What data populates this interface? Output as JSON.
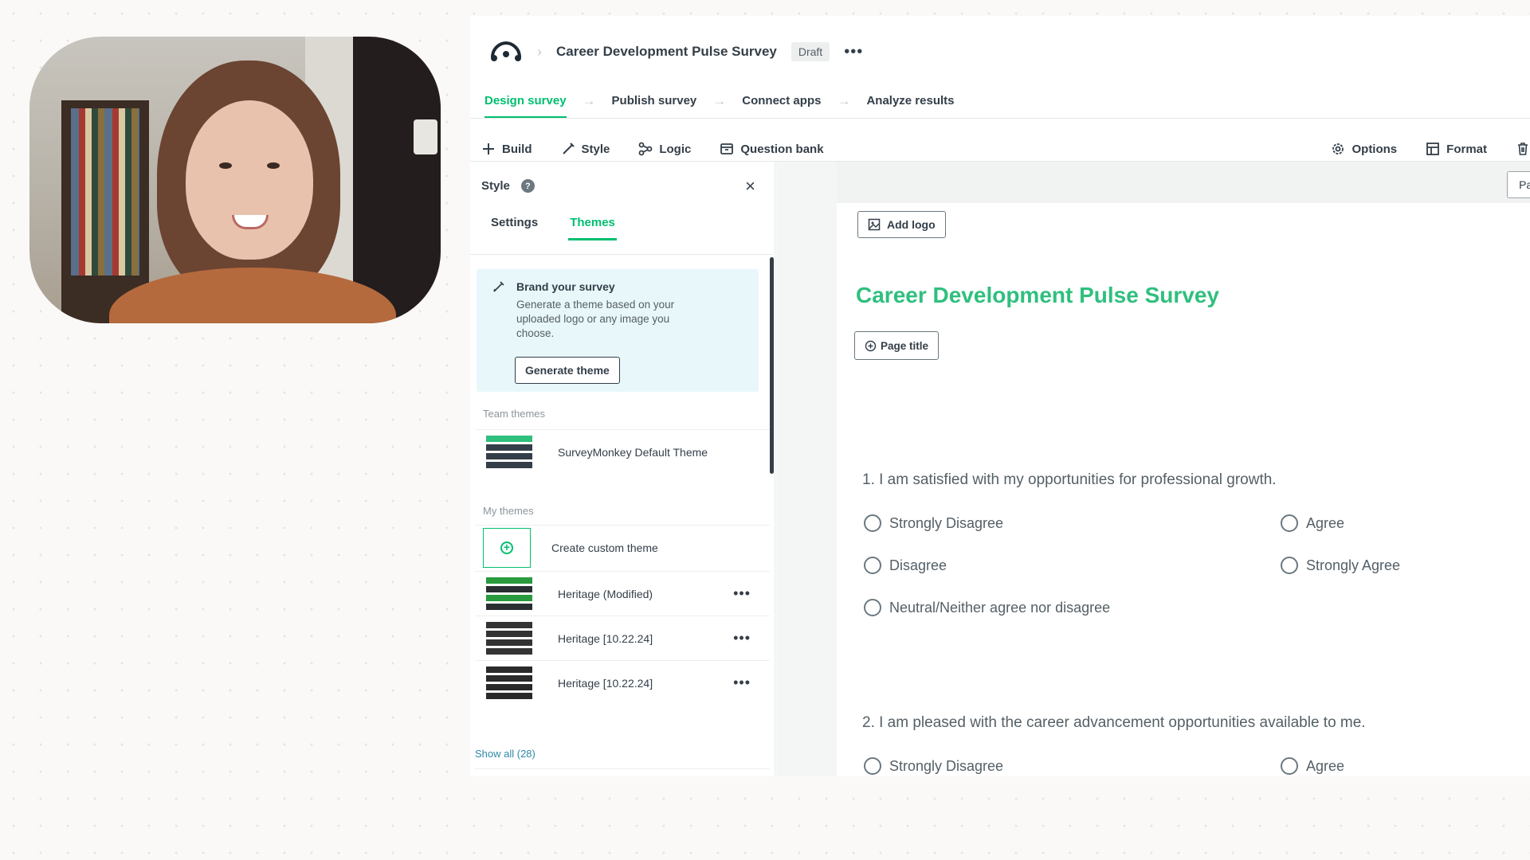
{
  "header": {
    "survey_name": "Career Development Pulse Survey",
    "status_badge": "Draft",
    "more": "•••"
  },
  "steps": [
    {
      "label": "Design survey",
      "active": true
    },
    {
      "label": "Publish survey",
      "active": false
    },
    {
      "label": "Connect apps",
      "active": false
    },
    {
      "label": "Analyze results",
      "active": false
    }
  ],
  "toolbar": {
    "build": "Build",
    "style": "Style",
    "logic": "Logic",
    "question_bank": "Question bank",
    "options": "Options",
    "format": "Format"
  },
  "style_panel": {
    "title": "Style",
    "help": "?",
    "close": "×",
    "tabs": [
      {
        "label": "Settings",
        "active": false
      },
      {
        "label": "Themes",
        "active": true
      }
    ],
    "brand": {
      "title": "Brand your survey",
      "description": "Generate a theme based on your uploaded logo or any image you choose.",
      "button": "Generate theme"
    },
    "team_themes_label": "Team themes",
    "team_themes": [
      {
        "name": "SurveyMonkey Default Theme",
        "colors": [
          "#2fbf7e",
          "#333e48",
          "#333e48",
          "#333e48"
        ]
      }
    ],
    "my_themes_label": "My themes",
    "create_custom": "Create custom theme",
    "my_themes": [
      {
        "name": "Heritage (Modified)",
        "more": "•••",
        "colors": [
          "#2a9a3e",
          "#2a2e33",
          "#2a9a3e",
          "#2a2e33"
        ]
      },
      {
        "name": "Heritage [10.22.24]",
        "more": "•••",
        "colors": [
          "#333333",
          "#333333",
          "#333333",
          "#333333"
        ]
      },
      {
        "name": "Heritage [10.22.24]",
        "more": "•••",
        "colors": [
          "#2a2a2a",
          "#2a2a2a",
          "#2a2a2a",
          "#2a2a2a"
        ]
      }
    ],
    "show_all": "Show all (28)"
  },
  "canvas": {
    "page_chip": "Pag",
    "add_logo": "Add logo",
    "heading": "Career Development Pulse Survey",
    "page_title_button": "Page title",
    "questions": [
      {
        "text": "1. I am satisfied with my opportunities for professional growth.",
        "options": [
          "Strongly Disagree",
          "Agree",
          "Disagree",
          "Strongly Agree",
          "Neutral/Neither agree nor disagree"
        ]
      },
      {
        "text": "2. I am pleased with the career advancement opportunities available to me.",
        "options": [
          "Strongly Disagree",
          "Agree"
        ]
      }
    ]
  },
  "colors": {
    "accent": "#00bf6f",
    "heading": "#2fbf7e",
    "brand_box": "#e8f7fa"
  }
}
